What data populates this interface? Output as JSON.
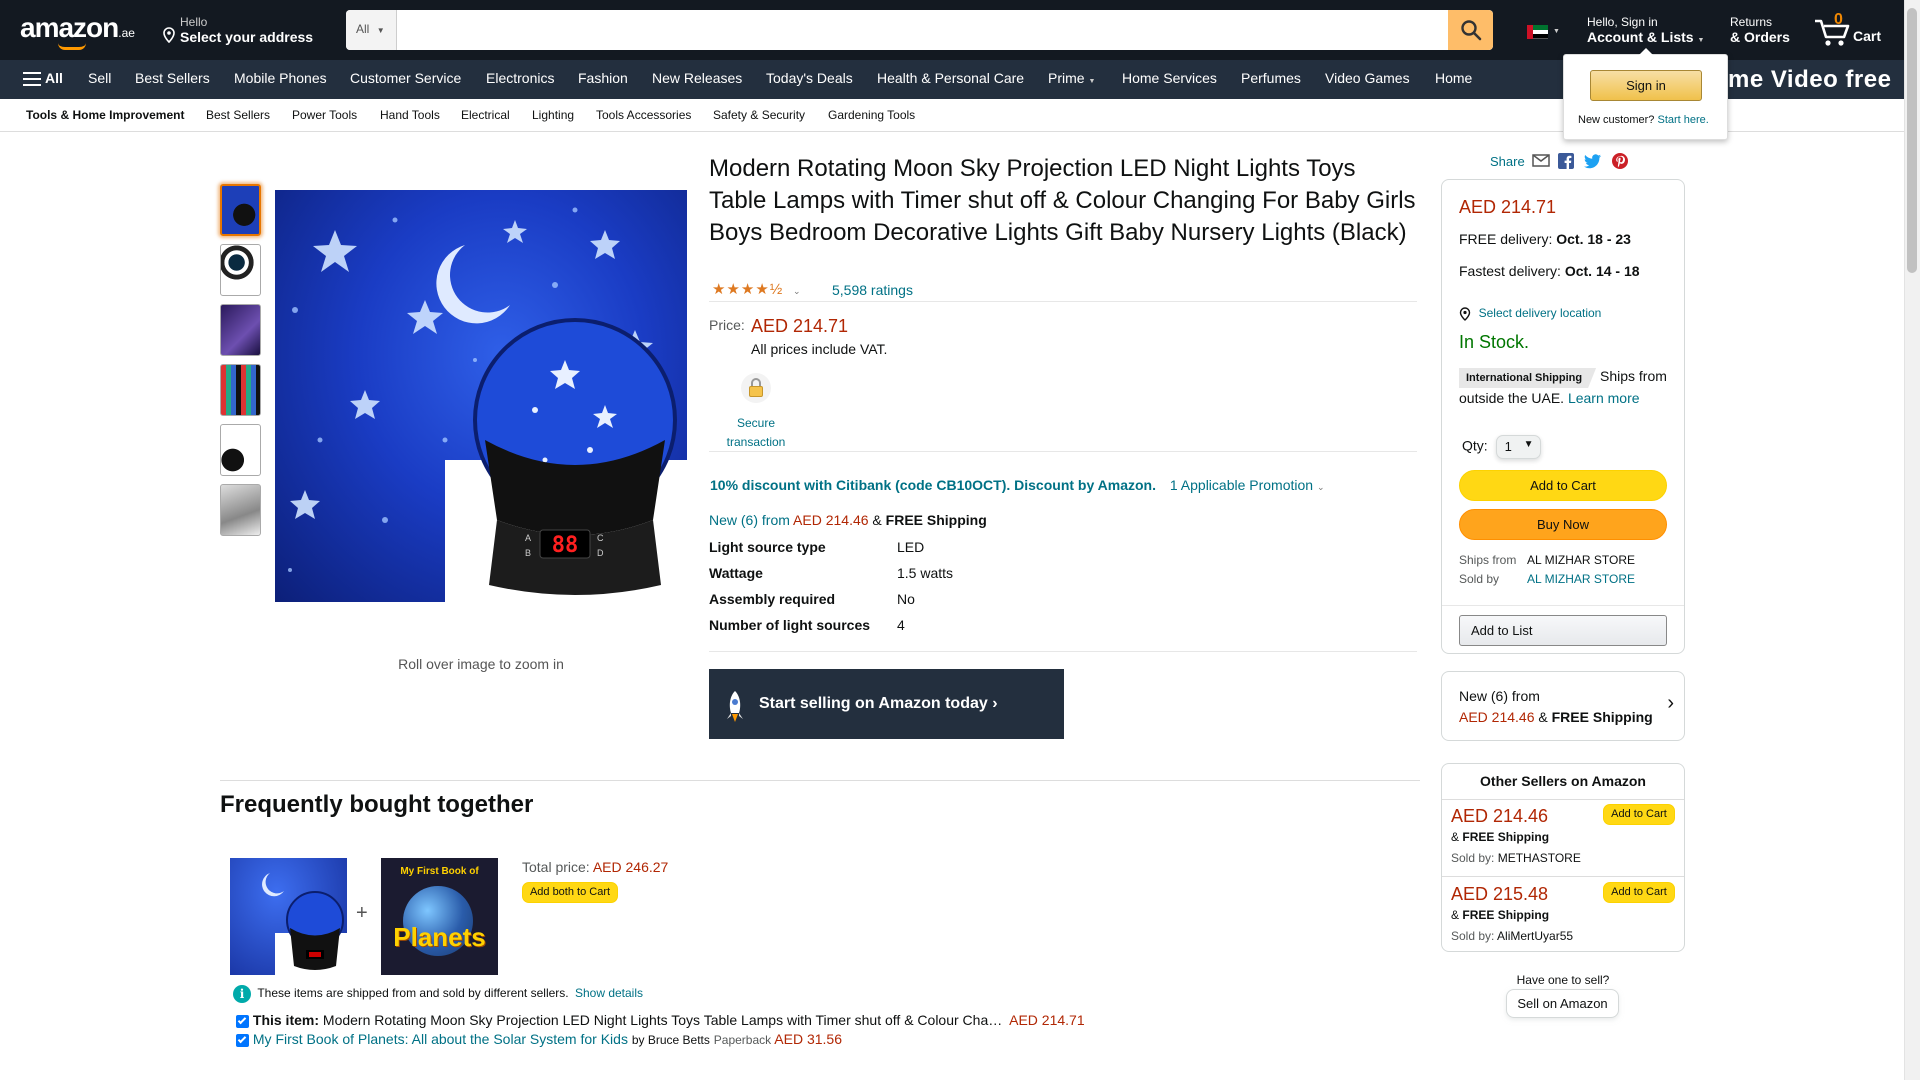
{
  "header": {
    "logo": "amazon",
    "logo_suffix": ".ae",
    "deliver_small": "Hello",
    "deliver_big": "Select your address",
    "search_category": "All",
    "search_placeholder": "",
    "account_small": "Hello, Sign in",
    "account_big": "Account & Lists",
    "returns_small": "Returns",
    "returns_big": "& Orders",
    "cart_count": "0",
    "cart_label": "Cart"
  },
  "signin_flyout": {
    "button": "Sign in",
    "new_customer": "New customer?",
    "start_here": "Start here."
  },
  "promo_banner": "me Video free",
  "nav": {
    "all": "All",
    "links": [
      "Sell",
      "Best Sellers",
      "Mobile Phones",
      "Customer Service",
      "Electronics",
      "Fashion",
      "New Releases",
      "Today's Deals",
      "Health & Personal Care",
      "Prime",
      "Home Services",
      "Perfumes",
      "Video Games",
      "Home"
    ]
  },
  "subnav": {
    "category": "Tools & Home Improvement",
    "links": [
      "Best Sellers",
      "Power Tools",
      "Hand Tools",
      "Electrical",
      "Lighting",
      "Tools Accessories",
      "Safety & Security",
      "Gardening Tools"
    ]
  },
  "gallery": {
    "zoom_hint": "Roll over image to zoom in",
    "display_digits": "88",
    "display_letters": [
      "A",
      "B",
      "C",
      "D"
    ]
  },
  "product": {
    "title": "Modern Rotating Moon Sky Projection LED Night Lights Toys Table Lamps with Timer shut off & Colour Changing For Baby Girls Boys Bedroom Decorative Lights Gift Baby Nursery Lights (Black)",
    "rating": 4.5,
    "stars": "★★★★½",
    "ratings_count": "5,598 ratings",
    "price_label": "Price:",
    "price": "AED 214.71",
    "vat_note": "All prices include VAT.",
    "secure_line1": "Secure",
    "secure_line2": "transaction",
    "promo_text": "10% discount with Citibank (code CB10OCT). Discount by Amazon.",
    "promo_link": "1 Applicable Promotion",
    "new_offers_link": "New (6) from",
    "new_offers_price": "AED 214.46",
    "new_offers_amp": "&",
    "new_offers_shipping": "FREE Shipping",
    "specs": [
      {
        "key": "Light source type",
        "value": "LED"
      },
      {
        "key": "Wattage",
        "value": "1.5 watts"
      },
      {
        "key": "Assembly required",
        "value": "No"
      },
      {
        "key": "Number of light sources",
        "value": "4"
      }
    ],
    "sell_banner": "Start selling on Amazon today ›"
  },
  "share": {
    "label": "Share"
  },
  "buybox": {
    "price": "AED 214.71",
    "free_delivery_label": "FREE delivery:",
    "free_delivery_date": "Oct. 18 - 23",
    "fastest_label": "Fastest delivery:",
    "fastest_date": "Oct. 14 - 18",
    "location_link": "Select delivery location",
    "stock": "In Stock.",
    "intl_badge": "International Shipping",
    "ships_text": "Ships from outside the UAE.",
    "learn_more": "Learn more",
    "qty_label": "Qty:",
    "qty_value": "1",
    "add_to_cart": "Add to Cart",
    "buy_now": "Buy Now",
    "ships_from_label": "Ships from",
    "ships_from_value": "AL MIZHAR STORE",
    "sold_by_label": "Sold by",
    "sold_by_value": "AL MIZHAR STORE",
    "add_to_list": "Add to List"
  },
  "new_box": {
    "line1": "New (6) from",
    "price": "AED 214.46",
    "amp": "&",
    "shipping": "FREE Shipping"
  },
  "other_sellers": {
    "title": "Other Sellers on Amazon",
    "offers": [
      {
        "price": "AED 214.46",
        "amp": "&",
        "shipping": "FREE Shipping",
        "sold_by_label": "Sold by:",
        "seller": "METHASTORE",
        "button": "Add to Cart"
      },
      {
        "price": "AED 215.48",
        "amp": "&",
        "shipping": "FREE Shipping",
        "sold_by_label": "Sold by:",
        "seller": "AliMertUyar55",
        "button": "Add to Cart"
      }
    ]
  },
  "sell_prompt": {
    "question": "Have one to sell?",
    "button": "Sell on Amazon"
  },
  "fbt": {
    "heading": "Frequently bought together",
    "plus": "+",
    "book_title_line1": "My First Book of",
    "book_title_line2": "Planets",
    "total_label": "Total price:",
    "total_price": "AED 246.27",
    "add_both": "Add both to Cart",
    "info_text": "These items are shipped from and sold by different sellers.",
    "show_details": "Show details",
    "item1_prefix": "This item:",
    "item1_title": "Modern Rotating Moon Sky Projection LED Night Lights Toys Table Lamps with Timer shut off & Colour Cha…",
    "item1_price": "AED 214.71",
    "item2_title": "My First Book of Planets: All about the Solar System for Kids",
    "item2_by": "by Bruce Betts",
    "item2_format": "Paperback",
    "item2_price": "AED 31.56"
  },
  "colors": {
    "header": "#131921",
    "subheader": "#232f3e",
    "price": "#b12704",
    "link": "#007185",
    "stock": "#007600",
    "yellow": "#ffd814",
    "orange": "#ffa41c"
  }
}
